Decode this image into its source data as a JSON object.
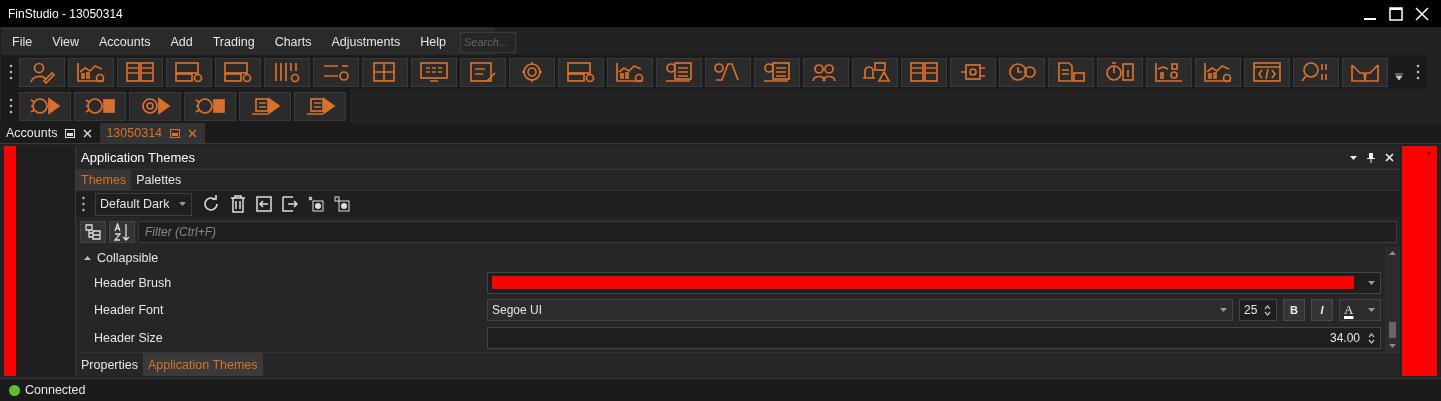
{
  "window": {
    "title": "FinStudio - 13050314"
  },
  "menu": {
    "items": [
      "File",
      "View",
      "Accounts",
      "Add",
      "Trading",
      "Charts",
      "Adjustments",
      "Help"
    ],
    "search": {
      "placeholder": "Search..."
    }
  },
  "document_tabs": [
    {
      "label": "Accounts",
      "selected": false
    },
    {
      "label": "13050314",
      "selected": true
    }
  ],
  "panel": {
    "title": "Application Themes",
    "tabs": [
      {
        "label": "Themes",
        "selected": true
      },
      {
        "label": "Palettes",
        "selected": false
      }
    ],
    "theme_select": {
      "value": "Default Dark"
    },
    "filter": {
      "placeholder": "Filter (Ctrl+F)"
    },
    "category": {
      "label": "Collapsible",
      "expanded": true,
      "properties": [
        {
          "kind": "color",
          "label": "Header Brush",
          "color": "#ff0000"
        },
        {
          "kind": "font",
          "label": "Header Font",
          "value": "Segoe UI",
          "size": "25",
          "bold": "B",
          "italic": "I",
          "font_color": "A"
        },
        {
          "kind": "number",
          "label": "Header Size",
          "value": "34.00"
        }
      ]
    },
    "bottom_tabs": [
      {
        "label": "Properties",
        "selected": false
      },
      {
        "label": "Application Themes",
        "selected": true
      }
    ]
  },
  "status_bar": {
    "text": "Connected",
    "connected": true
  }
}
